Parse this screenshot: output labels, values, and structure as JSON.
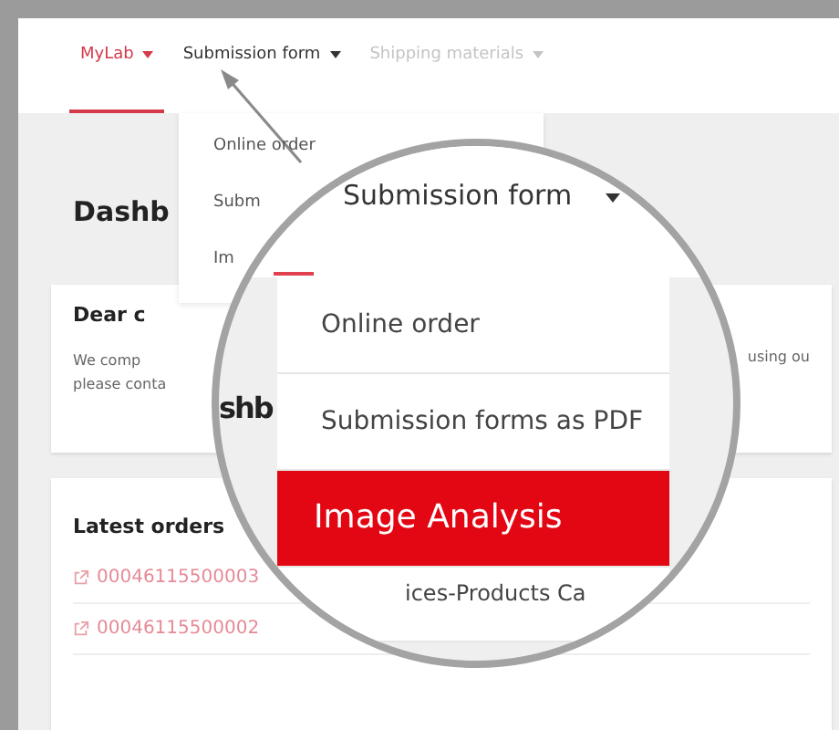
{
  "background_page": {
    "nav": [
      {
        "label": "MyLab",
        "selected": true,
        "disabled": false
      },
      {
        "label": "Submission form",
        "selected": false,
        "disabled": false
      },
      {
        "label": "Shipping materials",
        "selected": false,
        "disabled": true
      }
    ],
    "dropdown": [
      "Online order",
      "Subm",
      "Im"
    ],
    "heading": "Dashb",
    "notice": {
      "title": "Dear c",
      "lines": [
        "We comp",
        "please conta"
      ],
      "trailing": "using ou"
    },
    "orders": {
      "title": "Latest orders",
      "links": [
        "00046115500003",
        "00046115500002"
      ]
    }
  },
  "magnifier": {
    "nav_label": "Submission form",
    "heading": "shb",
    "menu": [
      {
        "label": "Online order",
        "selected": false
      },
      {
        "label": "Submission forms as PDF",
        "selected": false
      },
      {
        "label": "Image Analysis",
        "selected": true
      },
      {
        "label": "ices-Products Ca",
        "selected": false
      }
    ]
  }
}
